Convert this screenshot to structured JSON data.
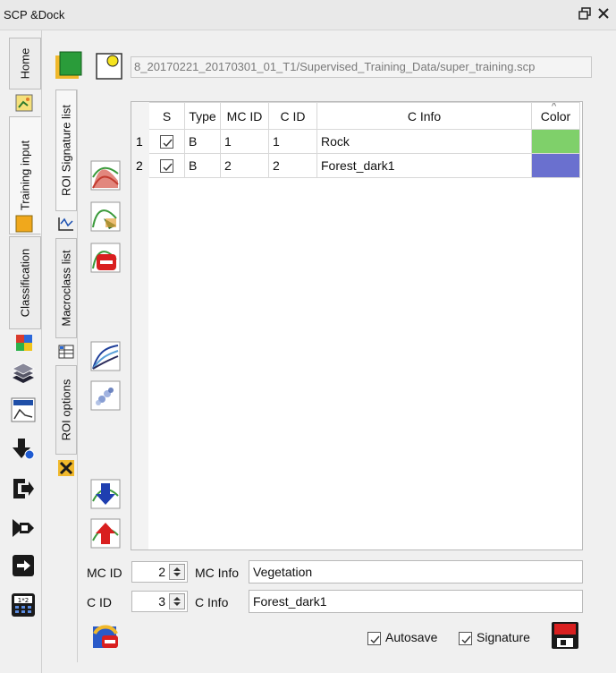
{
  "window": {
    "title": "SCP &Dock",
    "float_icon": "float-restore-icon",
    "close_icon": "close-icon"
  },
  "left_tabs": {
    "home": "Home",
    "training_input": "Training input",
    "classification": "Classification"
  },
  "toolbar": {
    "path": "8_20170221_20170301_01_T1/Supervised_Training_Data/super_training.scp"
  },
  "sub_tabs": {
    "roi_signature_list": "ROI Signature list",
    "macroclass_list": "Macroclass list",
    "roi_options": "ROI options"
  },
  "table": {
    "columns": [
      "S",
      "Type",
      "MC ID",
      "C ID",
      "C Info",
      "Color"
    ],
    "rows": [
      {
        "num": "1",
        "checked": true,
        "type": "B",
        "mc_id": "1",
        "c_id": "1",
        "c_info": "Rock",
        "color": "#7fd06a"
      },
      {
        "num": "2",
        "checked": true,
        "type": "B",
        "mc_id": "2",
        "c_id": "2",
        "c_info": "Forest_dark1",
        "color": "#6a70cf"
      }
    ]
  },
  "form": {
    "mc_id_label": "MC ID",
    "mc_id_value": "2",
    "mc_info_label": "MC Info",
    "mc_info_value": "Vegetation",
    "c_id_label": "C ID",
    "c_id_value": "3",
    "c_info_label": "C Info",
    "c_info_value": "Forest_dark1",
    "autosave_label": "Autosave",
    "signature_label": "Signature"
  }
}
